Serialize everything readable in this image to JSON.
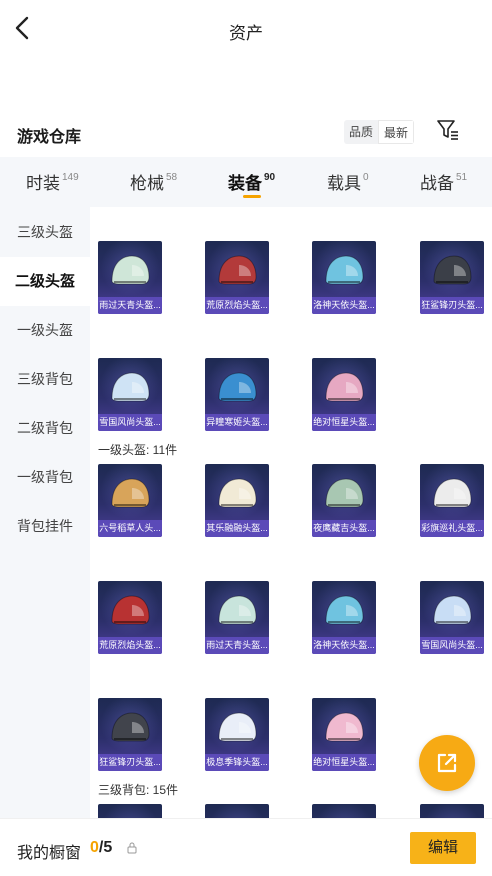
{
  "header": {
    "title": "资产"
  },
  "section": {
    "title": "游戏仓库",
    "sort_options": [
      "品质",
      "最新"
    ],
    "sort_active": "最新"
  },
  "tabs": [
    {
      "label": "时装",
      "count": "149"
    },
    {
      "label": "枪械",
      "count": "58"
    },
    {
      "label": "装备",
      "count": "90"
    },
    {
      "label": "载具",
      "count": "0"
    },
    {
      "label": "战备",
      "count": "51"
    }
  ],
  "categories": [
    "三级头盔",
    "二级头盔",
    "一级头盔",
    "三级背包",
    "二级背包",
    "一级背包",
    "背包挂件"
  ],
  "groups": [
    {
      "title": "",
      "items": [
        {
          "name": "雨过天青头盔...",
          "tint": "#cfe6d8"
        },
        {
          "name": "荒原烈焰头盔...",
          "tint": "#b33a3a"
        },
        {
          "name": "洛神天依头盔...",
          "tint": "#6fc3e0"
        },
        {
          "name": "狂鲨锋刃头盔...",
          "tint": "#3b3f48"
        },
        {
          "name": "雪国风尚头盔...",
          "tint": "#cfe3f5"
        },
        {
          "name": "异瞳寒姬头盔...",
          "tint": "#3a8fd0"
        },
        {
          "name": "绝对恒星头盔...",
          "tint": "#e6a8c2"
        }
      ]
    },
    {
      "title": "一级头盔: 11件",
      "items": [
        {
          "name": "六号稻草人头...",
          "tint": "#d8a45a"
        },
        {
          "name": "其乐融融头盔...",
          "tint": "#f1ead6"
        },
        {
          "name": "夜鹰藏吉头盔...",
          "tint": "#a8c7b2"
        },
        {
          "name": "彩旗巡礼头盔...",
          "tint": "#ececec"
        },
        {
          "name": "荒原烈焰头盔...",
          "tint": "#b83232"
        },
        {
          "name": "雨过天青头盔...",
          "tint": "#c8e4dc"
        },
        {
          "name": "洛神天依头盔...",
          "tint": "#6fc3e0"
        },
        {
          "name": "雪国风尚头盔...",
          "tint": "#c8ddf5"
        },
        {
          "name": "狂鲨锋刃头盔...",
          "tint": "#41444c"
        },
        {
          "name": "极息季锋头盔...",
          "tint": "#e9eef8"
        },
        {
          "name": "绝对恒星头盔...",
          "tint": "#f0b9cf"
        }
      ]
    },
    {
      "title": "三级背包: 15件",
      "items": []
    }
  ],
  "bottom": {
    "window_label": "我的橱窗",
    "current": "0",
    "total": "/5",
    "edit_label": "编辑"
  },
  "colors": {
    "accent": "#f5a300",
    "card_label": "#5b4ab8"
  }
}
